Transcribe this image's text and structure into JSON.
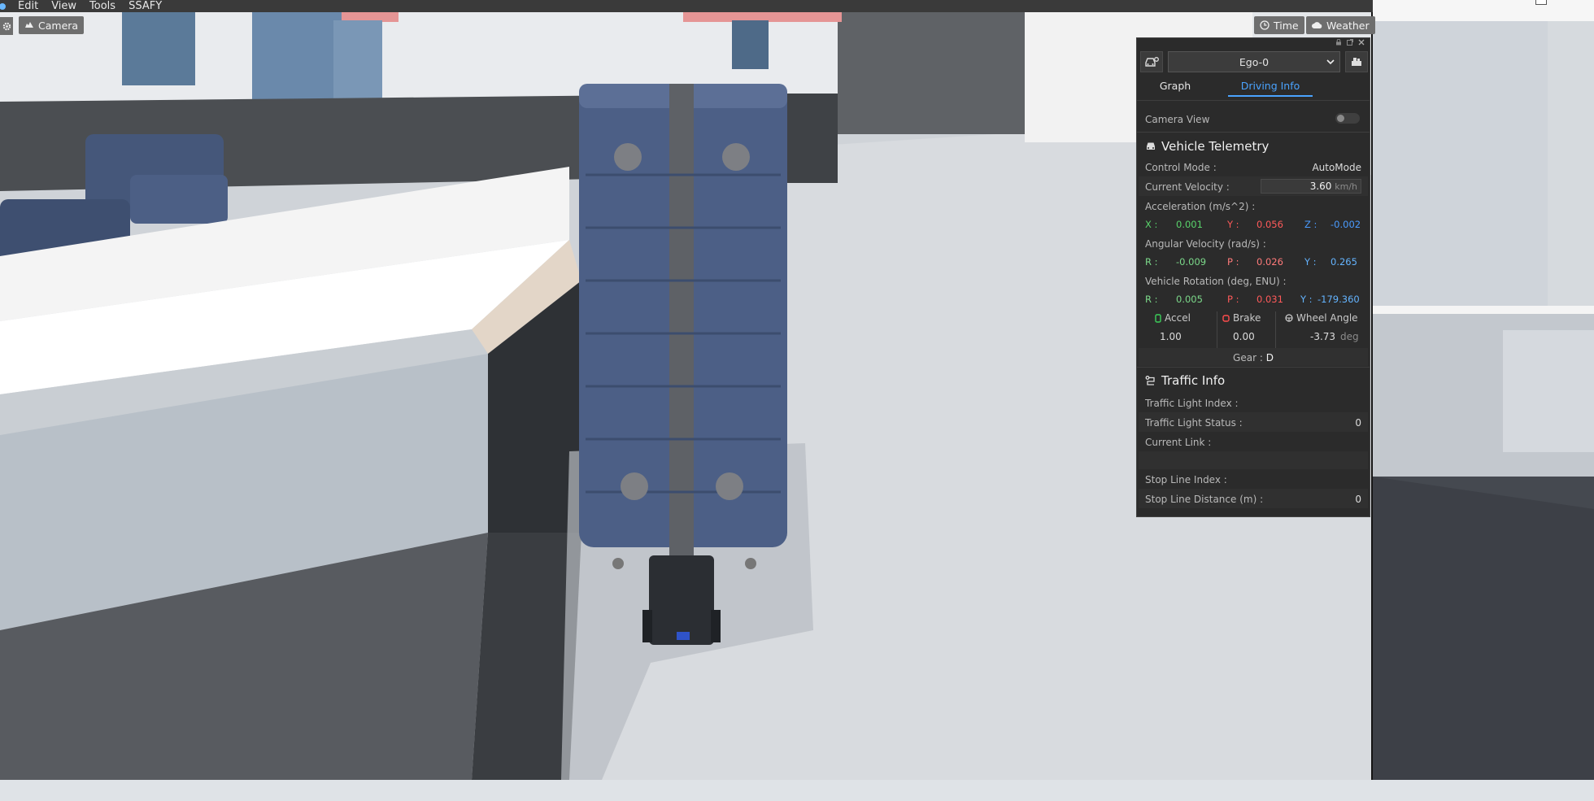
{
  "menu": {
    "items": [
      "Edit",
      "View",
      "Tools",
      "SSAFY"
    ]
  },
  "toolbar": {
    "camera_label": "Camera",
    "time_label": "Time",
    "weather_label": "Weather"
  },
  "panel": {
    "ego_selected": "Ego-0",
    "tabs": {
      "graph": "Graph",
      "driving_info": "Driving Info"
    },
    "camera_view_label": "Camera View",
    "camera_view_on": false,
    "telemetry": {
      "title": "Vehicle Telemetry",
      "control_mode_label": "Control Mode :",
      "control_mode_value": "AutoMode",
      "velocity_label": "Current Velocity :",
      "velocity_value": "3.60",
      "velocity_unit": "km/h",
      "accel_label": "Acceleration (m/s^2) :",
      "accel": {
        "x_label": "X :",
        "x": "0.001",
        "y_label": "Y :",
        "y": "0.056",
        "z_label": "Z :",
        "z": "-0.002"
      },
      "angvel_label": "Angular Velocity (rad/s) :",
      "angvel": {
        "r_label": "R :",
        "r": "-0.009",
        "p_label": "P :",
        "p": "0.026",
        "y_label": "Y :",
        "y": "0.265"
      },
      "rotation_label": "Vehicle Rotation (deg, ENU) :",
      "rotation": {
        "r_label": "R :",
        "r": "0.005",
        "p_label": "P :",
        "p": "0.031",
        "y_label": "Y :",
        "y": "-179.360"
      },
      "pedals": {
        "accel_label": "Accel",
        "accel_value": "1.00",
        "brake_label": "Brake",
        "brake_value": "0.00",
        "wheel_label": "Wheel Angle",
        "wheel_value": "-3.73",
        "wheel_unit": "deg"
      },
      "gear_label": "Gear :",
      "gear_value": "D"
    },
    "traffic": {
      "title": "Traffic Info",
      "light_index_label": "Traffic Light Index :",
      "light_index_value": "",
      "light_status_label": "Traffic Light Status :",
      "light_status_value": "0",
      "current_link_label": "Current Link :",
      "current_link_value": "",
      "stop_line_index_label": "Stop Line Index :",
      "stop_line_index_value": "",
      "stop_line_distance_label": "Stop Line Distance (m) :",
      "stop_line_distance_value": "0"
    }
  },
  "colors": {
    "accent": "#4aa3ff",
    "panel_bg": "#2b2b2b",
    "x_green": "#59d36b",
    "y_red": "#ff5a5a",
    "z_blue": "#4a9bff"
  }
}
